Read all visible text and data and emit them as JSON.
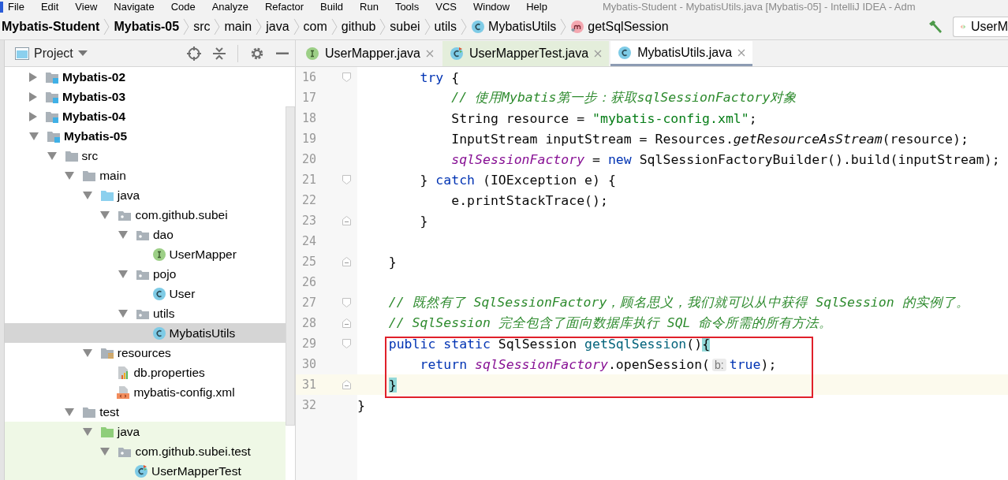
{
  "window": {
    "title": "Mybatis-Student - MybatisUtils.java [Mybatis-05] - IntelliJ IDEA - Adm"
  },
  "menu": [
    "File",
    "Edit",
    "View",
    "Navigate",
    "Code",
    "Analyze",
    "Refactor",
    "Build",
    "Run",
    "Tools",
    "VCS",
    "Window",
    "Help"
  ],
  "breadcrumbs": [
    {
      "label": "Mybatis-Student",
      "kind": "project"
    },
    {
      "label": "Mybatis-05",
      "kind": "project"
    },
    {
      "label": "src",
      "kind": "dir"
    },
    {
      "label": "main",
      "kind": "dir"
    },
    {
      "label": "java",
      "kind": "dir"
    },
    {
      "label": "com",
      "kind": "dir"
    },
    {
      "label": "github",
      "kind": "dir"
    },
    {
      "label": "subei",
      "kind": "dir"
    },
    {
      "label": "utils",
      "kind": "dir"
    },
    {
      "label": "MybatisUtils",
      "kind": "class"
    },
    {
      "label": "getSqlSession",
      "kind": "method"
    }
  ],
  "run_config": {
    "label": "UserM"
  },
  "project_panel": {
    "title": "Project",
    "tree": [
      {
        "label": "Mybatis-02",
        "kind": "module",
        "expanded": false,
        "selected": false
      },
      {
        "label": "Mybatis-03",
        "kind": "module",
        "expanded": false,
        "selected": false
      },
      {
        "label": "Mybatis-04",
        "kind": "module",
        "expanded": false,
        "selected": false
      },
      {
        "label": "Mybatis-05",
        "kind": "module",
        "expanded": true,
        "selected": false,
        "children": [
          {
            "label": "src",
            "kind": "folder",
            "expanded": true,
            "selected": false,
            "children": [
              {
                "label": "main",
                "kind": "folder",
                "expanded": true,
                "selected": false,
                "children": [
                  {
                    "label": "java",
                    "kind": "source-folder",
                    "expanded": true,
                    "selected": false,
                    "children": [
                      {
                        "label": "com.github.subei",
                        "kind": "package",
                        "expanded": true,
                        "selected": false,
                        "children": [
                          {
                            "label": "dao",
                            "kind": "package",
                            "expanded": true,
                            "selected": false,
                            "children": [
                              {
                                "label": "UserMapper",
                                "kind": "interface",
                                "selected": false
                              }
                            ]
                          },
                          {
                            "label": "pojo",
                            "kind": "package",
                            "expanded": true,
                            "selected": false,
                            "children": [
                              {
                                "label": "User",
                                "kind": "class",
                                "selected": false
                              }
                            ]
                          },
                          {
                            "label": "utils",
                            "kind": "package",
                            "expanded": true,
                            "selected": false,
                            "children": [
                              {
                                "label": "MybatisUtils",
                                "kind": "class",
                                "selected": true
                              }
                            ]
                          }
                        ]
                      }
                    ]
                  },
                  {
                    "label": "resources",
                    "kind": "resources-folder",
                    "expanded": true,
                    "selected": false,
                    "children": [
                      {
                        "label": "db.properties",
                        "kind": "properties",
                        "selected": false
                      },
                      {
                        "label": "mybatis-config.xml",
                        "kind": "xml",
                        "selected": false
                      }
                    ]
                  }
                ]
              },
              {
                "label": "test",
                "kind": "folder",
                "expanded": true,
                "selected": false,
                "children": [
                  {
                    "label": "java",
                    "kind": "test-folder",
                    "expanded": true,
                    "selected": false,
                    "children": [
                      {
                        "label": "com.github.subei.test",
                        "kind": "package",
                        "expanded": true,
                        "selected": false,
                        "children": [
                          {
                            "label": "UserMapperTest",
                            "kind": "test-class",
                            "selected": false
                          }
                        ]
                      }
                    ]
                  }
                ]
              }
            ]
          }
        ]
      }
    ]
  },
  "editor": {
    "tabs": [
      {
        "label": "UserMapper.java",
        "kind": "interface",
        "selected": false
      },
      {
        "label": "UserMapperTest.java",
        "kind": "test-class",
        "selected": false
      },
      {
        "label": "MybatisUtils.java",
        "kind": "class",
        "selected": true
      }
    ],
    "lines": [
      {
        "number": "16",
        "fold_start": true,
        "fold_end": false,
        "current": false,
        "boxed": false,
        "tokens": [
          {
            "text": "        try",
            "kind": "kw"
          },
          {
            "text": " {",
            "kind": "plain"
          }
        ]
      },
      {
        "number": "17",
        "fold_start": false,
        "fold_end": false,
        "current": false,
        "boxed": false,
        "tokens": [
          {
            "text": "            // 使用Mybatis第一步：获取sqlSessionFactory对象",
            "kind": "comment"
          }
        ]
      },
      {
        "number": "18",
        "fold_start": false,
        "fold_end": false,
        "current": false,
        "boxed": false,
        "tokens": [
          {
            "text": "            String resource = ",
            "kind": "plain"
          },
          {
            "text": "\"mybatis-config.xml\"",
            "kind": "str"
          },
          {
            "text": ";",
            "kind": "plain"
          }
        ]
      },
      {
        "number": "19",
        "fold_start": false,
        "fold_end": false,
        "current": false,
        "boxed": false,
        "tokens": [
          {
            "text": "            InputStream inputStream = Resources.",
            "kind": "plain"
          },
          {
            "text": "getResourceAsStream",
            "kind": "static"
          },
          {
            "text": "(resource);",
            "kind": "plain"
          }
        ]
      },
      {
        "number": "20",
        "fold_start": false,
        "fold_end": false,
        "current": false,
        "boxed": false,
        "tokens": [
          {
            "text": "            sqlSessionFactory",
            "kind": "field"
          },
          {
            "text": " = ",
            "kind": "plain"
          },
          {
            "text": "new",
            "kind": "kw"
          },
          {
            "text": " SqlSessionFactoryBuilder().build(inputStream);",
            "kind": "plain"
          }
        ]
      },
      {
        "number": "21",
        "fold_start": true,
        "fold_end": false,
        "current": false,
        "boxed": false,
        "tokens": [
          {
            "text": "        } ",
            "kind": "plain"
          },
          {
            "text": "catch",
            "kind": "kw"
          },
          {
            "text": " (IOException e) {",
            "kind": "plain"
          }
        ]
      },
      {
        "number": "22",
        "fold_start": false,
        "fold_end": false,
        "current": false,
        "boxed": false,
        "tokens": [
          {
            "text": "            e.printStackTrace();",
            "kind": "plain"
          }
        ]
      },
      {
        "number": "23",
        "fold_start": false,
        "fold_end": true,
        "current": false,
        "boxed": false,
        "tokens": [
          {
            "text": "        }",
            "kind": "plain"
          }
        ]
      },
      {
        "number": "24",
        "fold_start": false,
        "fold_end": false,
        "current": false,
        "boxed": false
      },
      {
        "number": "25",
        "fold_start": false,
        "fold_end": true,
        "current": false,
        "boxed": false,
        "tokens": [
          {
            "text": "    }",
            "kind": "plain"
          }
        ]
      },
      {
        "number": "26",
        "fold_start": false,
        "fold_end": false,
        "current": false,
        "boxed": false
      },
      {
        "number": "27",
        "fold_start": true,
        "fold_end": false,
        "current": false,
        "boxed": false,
        "tokens": [
          {
            "text": "    // 既然有了 SqlSessionFactory，顾名思义，我们就可以从中获得 SqlSession 的实例了。",
            "kind": "comment"
          }
        ]
      },
      {
        "number": "28",
        "fold_start": false,
        "fold_end": true,
        "current": false,
        "boxed": false,
        "tokens": [
          {
            "text": "    // SqlSession 完全包含了面向数据库执行 SQL 命令所需的所有方法。",
            "kind": "comment"
          }
        ]
      },
      {
        "number": "29",
        "fold_start": true,
        "fold_end": false,
        "current": false,
        "boxed": true,
        "tokens": [
          {
            "text": "    public static",
            "kind": "kw"
          },
          {
            "text": " SqlSession ",
            "kind": "plain"
          },
          {
            "text": "getSqlSession",
            "kind": "decl"
          },
          {
            "text": "()",
            "kind": "plain"
          },
          {
            "text": "{",
            "kind": "brace"
          }
        ]
      },
      {
        "number": "30",
        "fold_start": false,
        "fold_end": false,
        "current": false,
        "boxed": true,
        "tokens": [
          {
            "text": "        return",
            "kind": "kw"
          },
          {
            "text": " sqlSessionFactory",
            "kind": "field"
          },
          {
            "text": ".openSession(",
            "kind": "plain"
          },
          {
            "text": "b:",
            "kind": "hint"
          },
          {
            "text": "true",
            "kind": "kw"
          },
          {
            "text": ");",
            "kind": "plain"
          }
        ]
      },
      {
        "number": "31",
        "fold_start": false,
        "fold_end": true,
        "current": true,
        "boxed": true,
        "tokens": [
          {
            "text": "    }",
            "kind": "brace"
          }
        ]
      },
      {
        "number": "32",
        "fold_start": false,
        "fold_end": false,
        "current": false,
        "boxed": false,
        "tokens": [
          {
            "text": "}",
            "kind": "plain"
          }
        ]
      }
    ]
  }
}
